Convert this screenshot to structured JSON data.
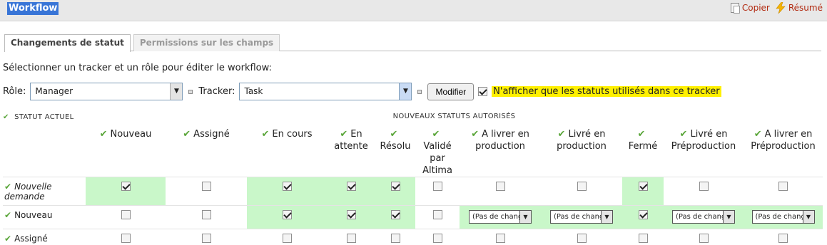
{
  "header": {
    "title": "Workflow",
    "copy_label": "Copier",
    "summary_label": "Résumé"
  },
  "tabs": [
    {
      "label": "Changements de statut",
      "active": true
    },
    {
      "label": "Permissions sur les champs",
      "active": false
    }
  ],
  "intro": "Sélectionner un tracker et un rôle pour éditer le workflow:",
  "controls": {
    "role_label": "Rôle:",
    "role_value": "Manager",
    "tracker_label": "Tracker:",
    "tracker_value": "Task",
    "modify_button": "Modifier",
    "only_used_checked": true,
    "only_used_label": "N'afficher que les statuts utilisés dans ce tracker"
  },
  "table": {
    "current_header": "STATUT ACTUEL",
    "new_header": "NOUVEAUX STATUTS AUTORISÉS",
    "columns": [
      {
        "line1": "Nouveau",
        "line2": "",
        "line3": ""
      },
      {
        "line1": "Assigné",
        "line2": "",
        "line3": ""
      },
      {
        "line1": "En cours",
        "line2": "",
        "line3": ""
      },
      {
        "line1": "En",
        "line2": "attente",
        "line3": ""
      },
      {
        "line1": "Résolu",
        "line2": "",
        "line3": ""
      },
      {
        "line1": "Validé",
        "line2": "par",
        "line3": "Altima"
      },
      {
        "line1": "A livrer en",
        "line2": "production",
        "line3": ""
      },
      {
        "line1": "Livré en",
        "line2": "production",
        "line3": ""
      },
      {
        "line1": "Fermé",
        "line2": "",
        "line3": ""
      },
      {
        "line1": "Livré en",
        "line2": "Préproduction",
        "line3": ""
      },
      {
        "line1": "A livrer en",
        "line2": "Préproduction",
        "line3": ""
      }
    ],
    "dropdown_label": "(Pas de changer",
    "rows": [
      {
        "label1": "Nouvelle",
        "label2": "demande",
        "italic": true
      },
      {
        "label1": "Nouveau",
        "label2": "",
        "italic": false
      },
      {
        "label1": "Assigné",
        "label2": "",
        "italic": false
      }
    ]
  },
  "colors": {
    "accent": "#3875d7",
    "allowed": "#c9f7c9",
    "highlight": "#fff000",
    "check": "#5aa63a"
  }
}
